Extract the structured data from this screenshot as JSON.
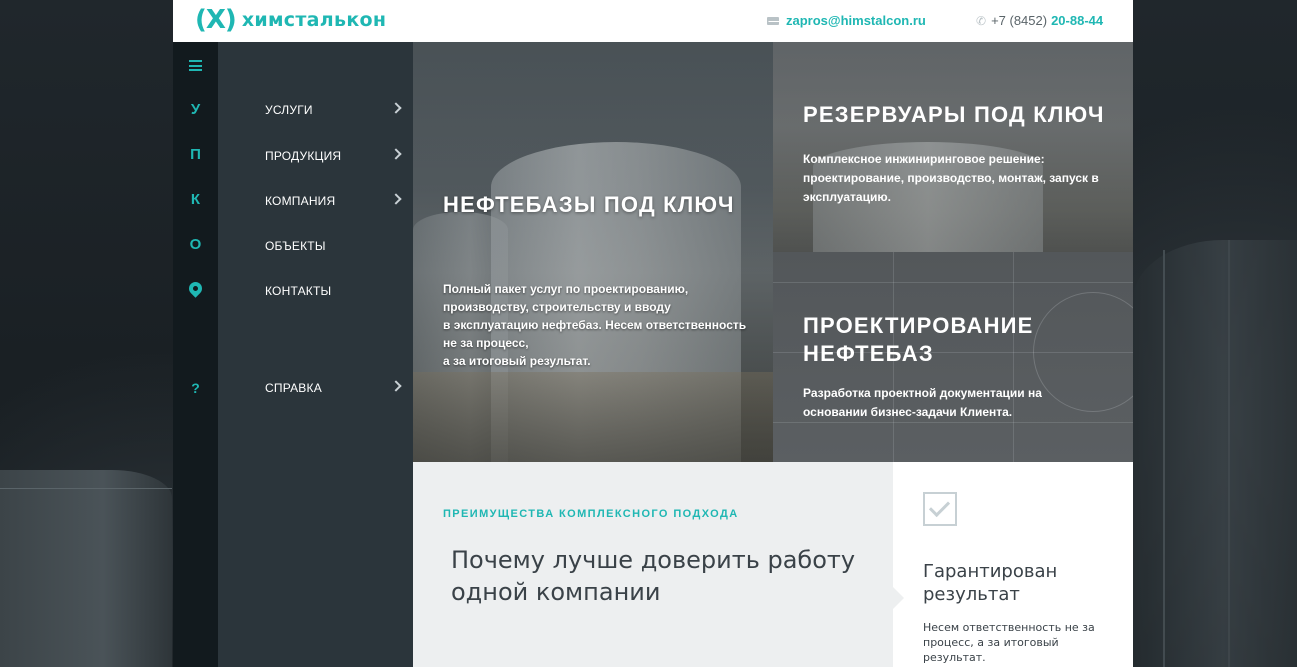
{
  "header": {
    "logo_mark": "(X)",
    "logo_text": "химсталькон",
    "email": "zapros@himstalcon.ru",
    "phone_prefix": "+7 (8452)",
    "phone_number": "20-88-44"
  },
  "rail": {
    "menu_icon": "hamburger-icon",
    "letters": [
      "У",
      "П",
      "К",
      "О"
    ],
    "location_icon": "map-pin-icon",
    "help": "?"
  },
  "menu": {
    "items": [
      {
        "label": "Услуги",
        "has_submenu": true
      },
      {
        "label": "Продукция",
        "has_submenu": true
      },
      {
        "label": "Компания",
        "has_submenu": true
      },
      {
        "label": "Объекты",
        "has_submenu": false
      },
      {
        "label": "Контакты",
        "has_submenu": false
      },
      {
        "label": "Справка",
        "has_submenu": true
      }
    ]
  },
  "hero": {
    "left": {
      "title": "Нефтебазы под ключ",
      "description": "Полный пакет услуг по проектированию,\nпроизводству, строительству и вводу\nв эксплуатацию нефтебаз. Несем ответственность\nне за процесс,\nа за итоговый результат."
    },
    "right_top": {
      "title": "Резервуары под ключ",
      "description": "Комплексное инжиниринговое решение: проектирование, производство, монтаж, запуск в эксплуатацию."
    },
    "right_bottom": {
      "title": "Проектирование нефтебаз",
      "description": "Разработка проектной документации на основании бизнес-задачи Клиента."
    }
  },
  "advantages": {
    "eyebrow": "Преимущества комплексного подхода",
    "heading": "Почему лучше доверить работу одной компании"
  },
  "card": {
    "icon": "checkbox-icon",
    "title": "Гарантирован результат",
    "text": "Несем ответственность не за процесс, а за итоговый результат."
  },
  "colors": {
    "accent": "#1fb7b3",
    "rail_bg": "#121a1e",
    "menu_bg": "#2b353b",
    "advantages_bg": "#edeff0"
  }
}
